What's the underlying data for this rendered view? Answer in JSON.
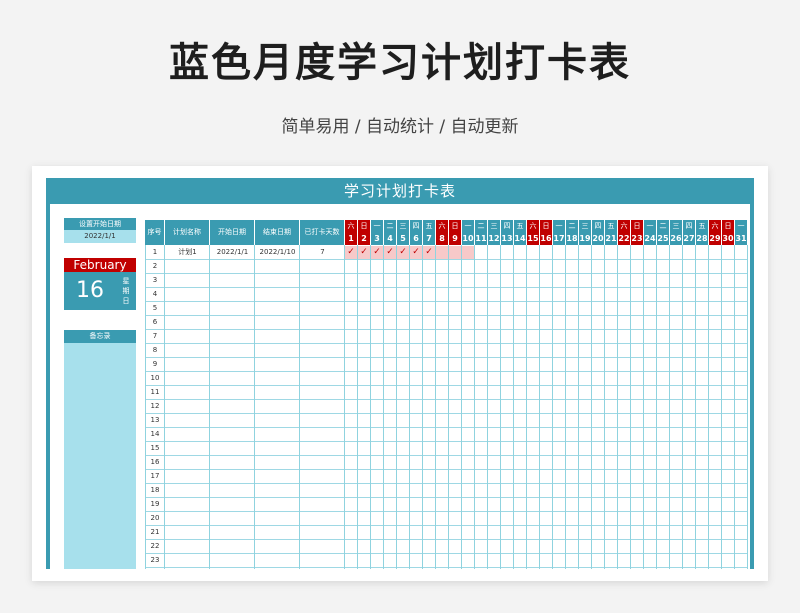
{
  "header": {
    "title": "蓝色月度学习计划打卡表",
    "subtitle": "简单易用 / 自动统计 / 自动更新"
  },
  "sheet": {
    "banner": "学习计划打卡表",
    "start_label": "设置开始日期",
    "start_value": "2022/1/1",
    "month": "February",
    "day": "16",
    "weekday_chars": [
      "星",
      "期",
      "日"
    ],
    "memo_label": "备忘录"
  },
  "table": {
    "columns": [
      "序号",
      "计划名称",
      "开始日期",
      "结束日期",
      "已打卡天数"
    ],
    "weekdays": [
      "六",
      "日",
      "一",
      "二",
      "三",
      "四",
      "五",
      "六",
      "日",
      "一",
      "二",
      "三",
      "四",
      "五",
      "六",
      "日",
      "一",
      "二",
      "三",
      "四",
      "五",
      "六",
      "日",
      "一",
      "二",
      "三",
      "四",
      "五",
      "六",
      "日",
      "一"
    ],
    "days": [
      "1",
      "2",
      "3",
      "4",
      "5",
      "6",
      "7",
      "8",
      "9",
      "10",
      "11",
      "12",
      "13",
      "14",
      "15",
      "16",
      "17",
      "18",
      "19",
      "20",
      "21",
      "22",
      "23",
      "24",
      "25",
      "26",
      "27",
      "28",
      "29",
      "30",
      "31"
    ],
    "rows": [
      {
        "no": "1",
        "name": "计划1",
        "start": "2022/1/1",
        "end": "2022/1/10",
        "count": "7",
        "checks": [
          "✓",
          "✓",
          "✓",
          "✓",
          "✓",
          "✓",
          "✓",
          "",
          "",
          ""
        ]
      }
    ],
    "row_numbers": [
      "2",
      "3",
      "4",
      "5",
      "6",
      "7",
      "8",
      "9",
      "10",
      "11",
      "12",
      "13",
      "14",
      "15",
      "16",
      "17",
      "18",
      "19",
      "20",
      "21",
      "22",
      "23"
    ],
    "check_color": "#f7c9c9"
  },
  "colors": {
    "teal": "#3a9bb1",
    "light_teal": "#a7e0ec",
    "weekend_red": "#c00000"
  }
}
